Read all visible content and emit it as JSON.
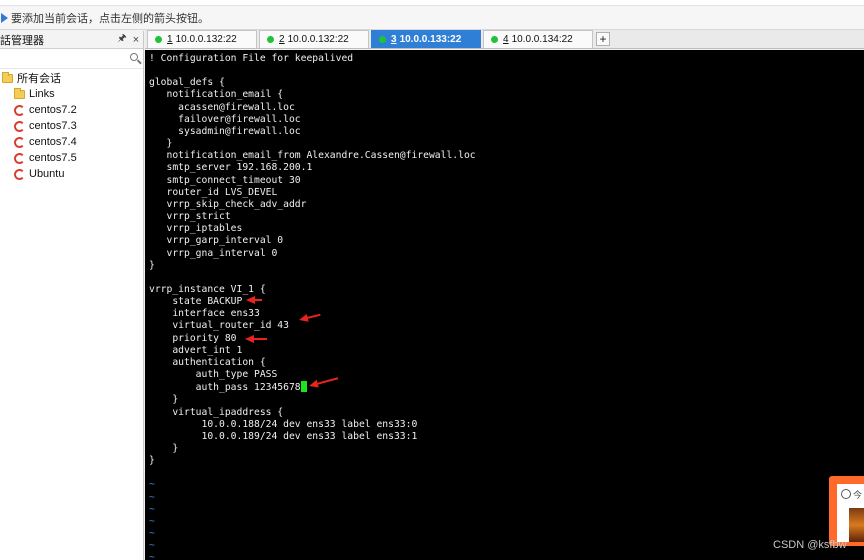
{
  "hint_bar": {
    "text": "要添加当前会话，点击左侧的箭头按钮。"
  },
  "session_manager": {
    "title": "話管理器",
    "pin_icon": "pin-icon",
    "close_label": "×",
    "tree": {
      "root": "所有会话",
      "items": [
        {
          "label": "Links",
          "type": "folder"
        },
        {
          "label": "centos7.2",
          "type": "session"
        },
        {
          "label": "centos7.3",
          "type": "session"
        },
        {
          "label": "centos7.4",
          "type": "session"
        },
        {
          "label": "centos7.5",
          "type": "session"
        },
        {
          "label": "Ubuntu",
          "type": "session"
        }
      ]
    }
  },
  "tabs": [
    {
      "num": "1",
      "label": "10.0.0.132:22",
      "active": false
    },
    {
      "num": "2",
      "label": "10.0.0.132:22",
      "active": false
    },
    {
      "num": "3",
      "label": "10.0.0.133:22",
      "active": true
    },
    {
      "num": "4",
      "label": "10.0.0.134:22",
      "active": false
    }
  ],
  "add_tab_label": "+",
  "terminal": {
    "lines": [
      "! Configuration File for keepalived",
      "",
      "global_defs {",
      "   notification_email {",
      "     acassen@firewall.loc",
      "     failover@firewall.loc",
      "     sysadmin@firewall.loc",
      "   }",
      "   notification_email_from Alexandre.Cassen@firewall.loc",
      "   smtp_server 192.168.200.1",
      "   smtp_connect_timeout 30",
      "   router_id LVS_DEVEL",
      "   vrrp_skip_check_adv_addr",
      "   vrrp_strict",
      "   vrrp_iptables",
      "   vrrp_garp_interval 0",
      "   vrrp_gna_interval 0",
      "}",
      "",
      "vrrp_instance VI_1 {",
      "    state BACKUP",
      "    interface ens33",
      "    virtual_router_id 43",
      "    priority 80",
      "    advert_int 1",
      "    authentication {",
      "        auth_type PASS",
      "        auth_pass 12345678",
      "    }",
      "    virtual_ipaddress {",
      "         10.0.0.188/24 dev ens33 label ens33:0",
      "         10.0.0.189/24 dev ens33 label ens33:1",
      "    }",
      "}",
      "",
      "~",
      "~",
      "~",
      "~",
      "~",
      "~",
      "~",
      "~"
    ],
    "cursor_line": 27
  },
  "widget": {
    "text": "今"
  },
  "watermark": "CSDN @ksfbw"
}
